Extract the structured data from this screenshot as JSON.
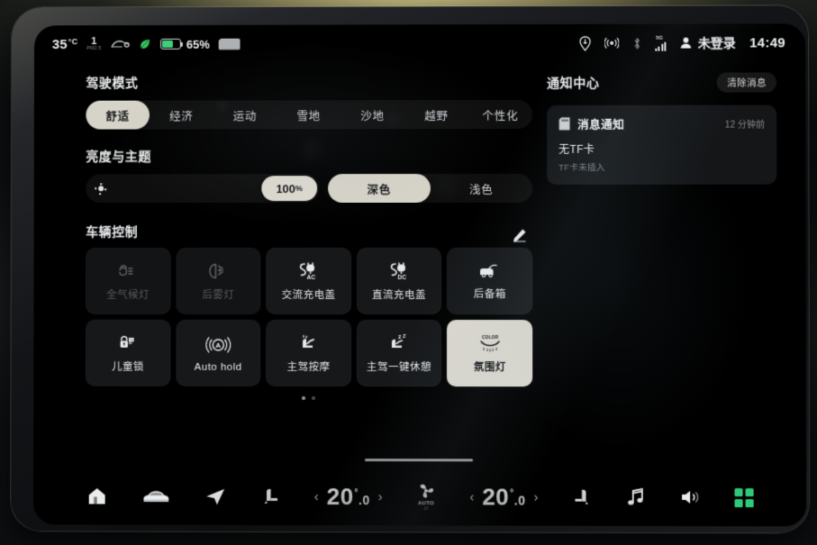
{
  "status_bar": {
    "outside_temp": "35",
    "temp_unit": "°C",
    "pm_value": "1",
    "pm_label": "PM2.5",
    "battery_percent": "65%",
    "battery_level": 65,
    "icons": [
      "car-pm-icon",
      "leaf-icon",
      "battery-icon",
      "sd-card-icon",
      "location-pin-icon",
      "wifi-hotspot-icon",
      "bluetooth-icon",
      "signal-5g-icon",
      "user-icon"
    ],
    "network_label": "5G",
    "user_label": "未登录",
    "clock": "14:49"
  },
  "drive_mode": {
    "title": "驾驶模式",
    "options": [
      {
        "label": "舒适",
        "active": true
      },
      {
        "label": "经济",
        "active": false
      },
      {
        "label": "运动",
        "active": false
      },
      {
        "label": "雪地",
        "active": false
      },
      {
        "label": "沙地",
        "active": false
      },
      {
        "label": "越野",
        "active": false
      },
      {
        "label": "个性化",
        "active": false
      }
    ]
  },
  "brightness_theme": {
    "title": "亮度与主题",
    "brightness_value": "100",
    "brightness_unit": "%",
    "brightness_percent": 100,
    "themes": [
      {
        "label": "深色",
        "active": true
      },
      {
        "label": "浅色",
        "active": false
      }
    ]
  },
  "vehicle_control": {
    "title": "车辆控制",
    "edit_icon": "pencil-icon",
    "page_dots": {
      "count": 2,
      "current": 1
    },
    "tiles": [
      {
        "label": "全气候灯",
        "icon": "all-weather-light-icon",
        "state": "disabled"
      },
      {
        "label": "后雾灯",
        "icon": "rear-fog-light-icon",
        "state": "disabled"
      },
      {
        "label": "交流充电盖",
        "icon": "ac-charge-port-icon",
        "state": "off"
      },
      {
        "label": "直流充电盖",
        "icon": "dc-charge-port-icon",
        "state": "off"
      },
      {
        "label": "后备箱",
        "icon": "trunk-icon",
        "state": "off"
      },
      {
        "label": "儿童锁",
        "icon": "child-lock-icon",
        "state": "off"
      },
      {
        "label": "Auto hold",
        "icon": "auto-hold-icon",
        "state": "off"
      },
      {
        "label": "主驾按摩",
        "icon": "driver-massage-icon",
        "state": "off"
      },
      {
        "label": "主驾一键休憩",
        "icon": "driver-rest-icon",
        "state": "off"
      },
      {
        "label": "氛围灯",
        "icon": "ambient-light-color-icon",
        "state": "on",
        "icon_text": "COLOR"
      }
    ]
  },
  "notification_center": {
    "title": "通知中心",
    "clear_label": "清除消息",
    "items": [
      {
        "icon": "sd-card-icon",
        "title": "消息通知",
        "time": "12 分钟前",
        "headline": "无TF卡",
        "subtext": "TF卡未插入"
      }
    ]
  },
  "dock": {
    "items": [
      {
        "name": "home-icon",
        "label": ""
      },
      {
        "name": "car-icon",
        "label": ""
      },
      {
        "name": "navigation-arrow-icon",
        "label": ""
      },
      {
        "name": "driver-seat-icon",
        "label": ""
      }
    ],
    "climate_left": {
      "value": "20",
      "decimal": ".0",
      "degree": "°",
      "prev": "‹",
      "next": "›"
    },
    "climate_right": {
      "value": "20",
      "decimal": ".0",
      "degree": "°",
      "prev": "‹",
      "next": "›"
    },
    "fan": {
      "icon": "fan-icon",
      "label": "AUTO"
    },
    "right_items": [
      {
        "name": "passenger-seat-icon"
      },
      {
        "name": "music-icon"
      },
      {
        "name": "volume-icon"
      },
      {
        "name": "app-grid-icon"
      }
    ]
  },
  "colors": {
    "accent_green": "#2ec97a",
    "active_pill": "#d6d3c8",
    "tile_bg": "#16181a",
    "screen_bg": "#000000"
  }
}
